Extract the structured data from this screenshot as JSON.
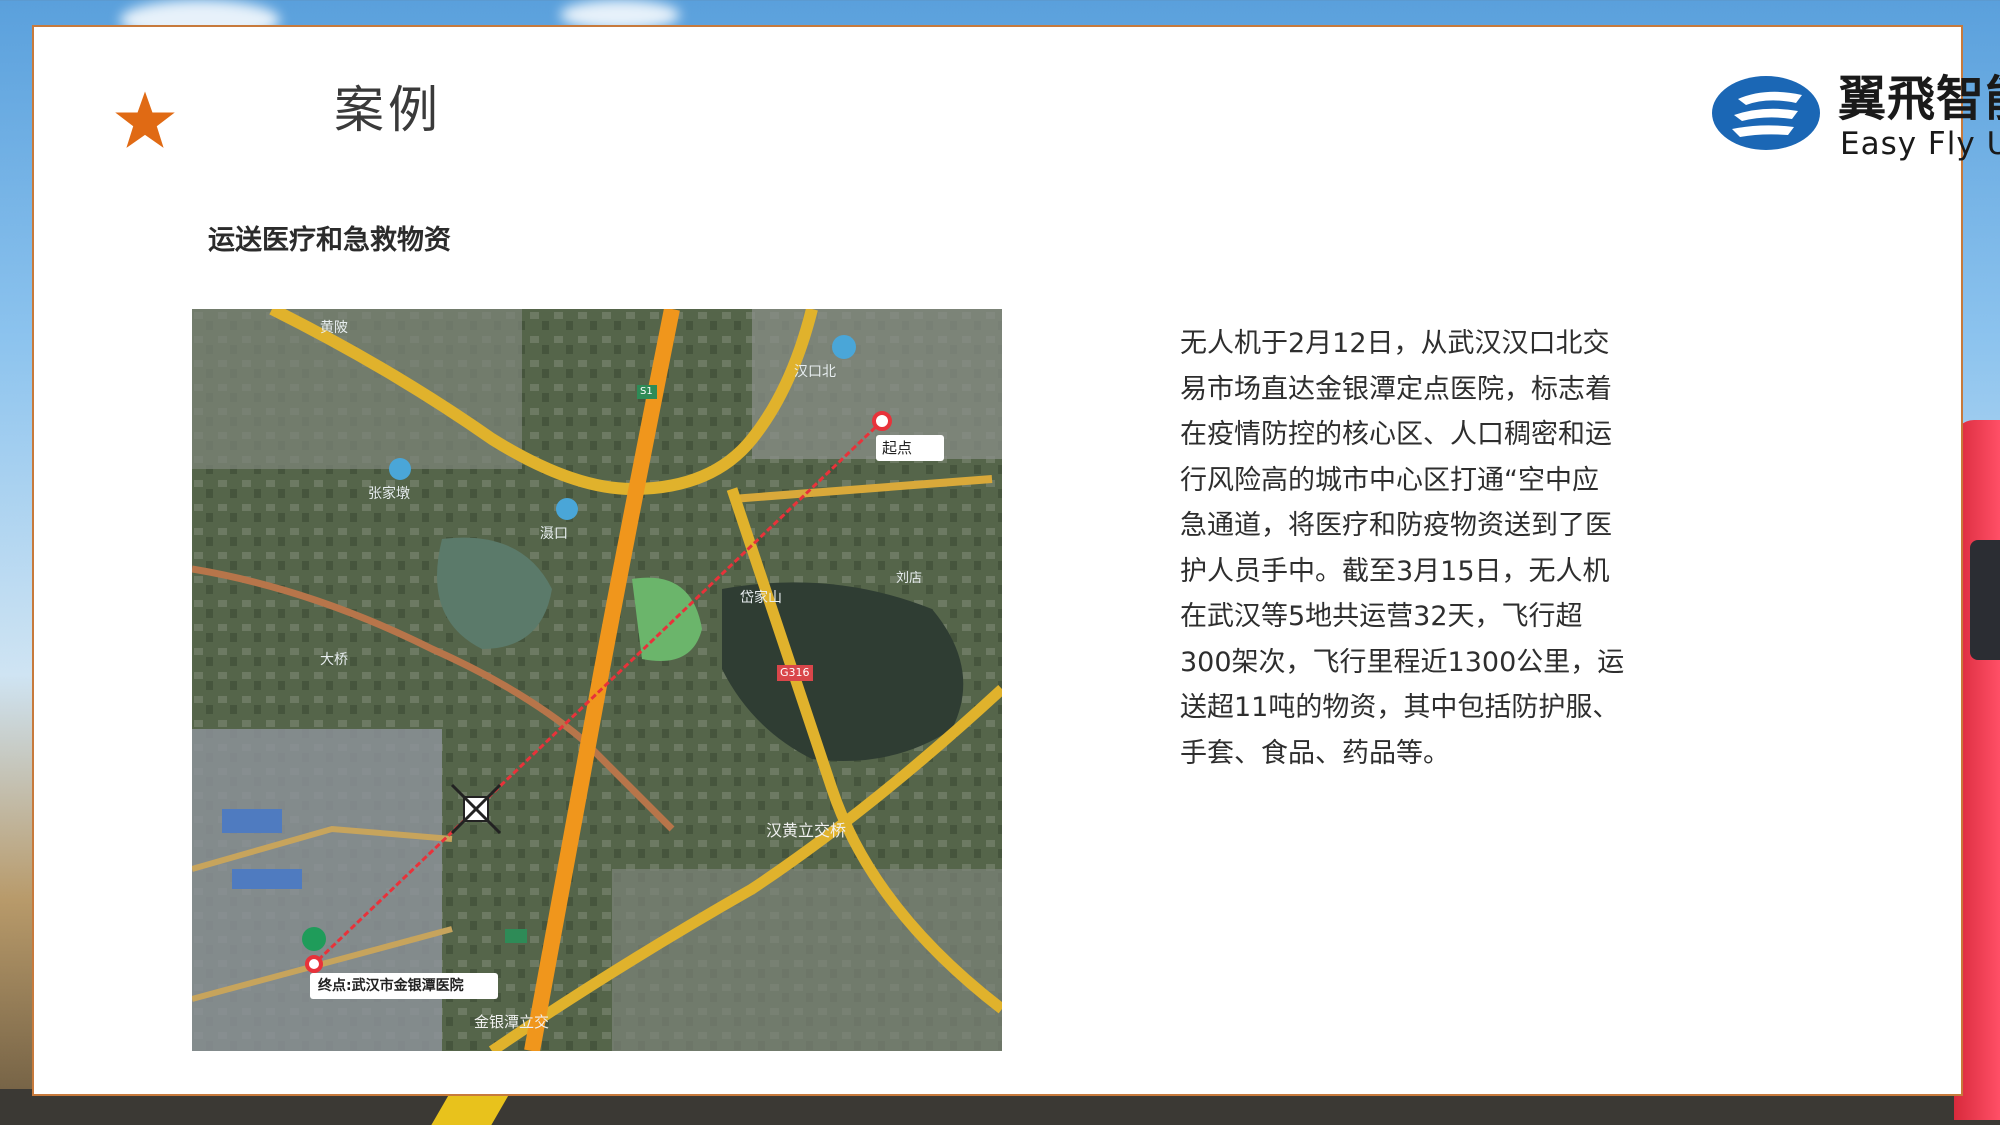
{
  "slide": {
    "heading": "案例",
    "subtitle": "运送医疗和急救物资",
    "body": "无人机于2月12日，从武汉汉口北交\n易市场直达金银潭定点医院，标志着\n在疫情防控的核心区、人口稠密和运\n行风险高的城市中心区打通“空中应\n急通道，将医疗和防疫物资送到了医\n护人员手中。截至3月15日，无人机\n在武汉等5地共运营32天，飞行超\n300架次，飞行里程近1300公里，运\n送超11吨的物资，其中包括防护服、\n手套、食品、药品等。"
  },
  "logo": {
    "name_cn": "翼飛智能",
    "name_en": "Easy Fly UAV"
  },
  "map": {
    "start_label": "起点",
    "end_label": "终点:武汉市金银潭医院",
    "place_labels": [
      "汉口北",
      "黄陂",
      "张家墩",
      "滠口",
      "岱家山",
      "大桥",
      "刘店",
      "G316",
      "S1",
      "汉黄立交桥",
      "金银潭立交"
    ]
  },
  "colors": {
    "accent_border": "#c77a3c",
    "star": "#e06a14",
    "logo_blue": "#1b67b5",
    "route_line": "#e8323a"
  },
  "icons": [
    "star-icon",
    "logo-mark-icon",
    "start-pin-icon",
    "end-pin-icon",
    "drone-icon"
  ]
}
